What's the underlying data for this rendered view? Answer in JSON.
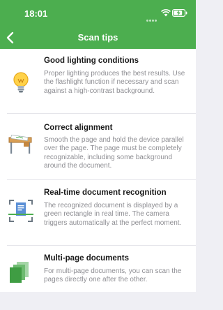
{
  "status": {
    "time": "18:01"
  },
  "nav": {
    "title": "Scan tips"
  },
  "tips": [
    {
      "title": "Good lighting conditions",
      "desc": "Proper lighting produces the best results. Use the flashlight function if necessary and scan against a high-contrast background.",
      "icon": "lightbulb-icon"
    },
    {
      "title": "Correct alignment",
      "desc": "Smooth the page and hold the device parallel over the page. The page must be completely recognizable, including some background around the document.",
      "icon": "desk-document-icon"
    },
    {
      "title": "Real-time document recognition",
      "desc": "The recognized document is displayed by a green rectangle in real time. The camera triggers automatically at the perfect moment.",
      "icon": "scan-frame-icon"
    },
    {
      "title": "Multi-page documents",
      "desc": "For multi-page documents, you can scan the pages directly one after the other.",
      "icon": "multi-page-icon"
    }
  ],
  "colors": {
    "header": "#4cae4f",
    "desc": "#8e8e93",
    "background": "#efeff4"
  }
}
